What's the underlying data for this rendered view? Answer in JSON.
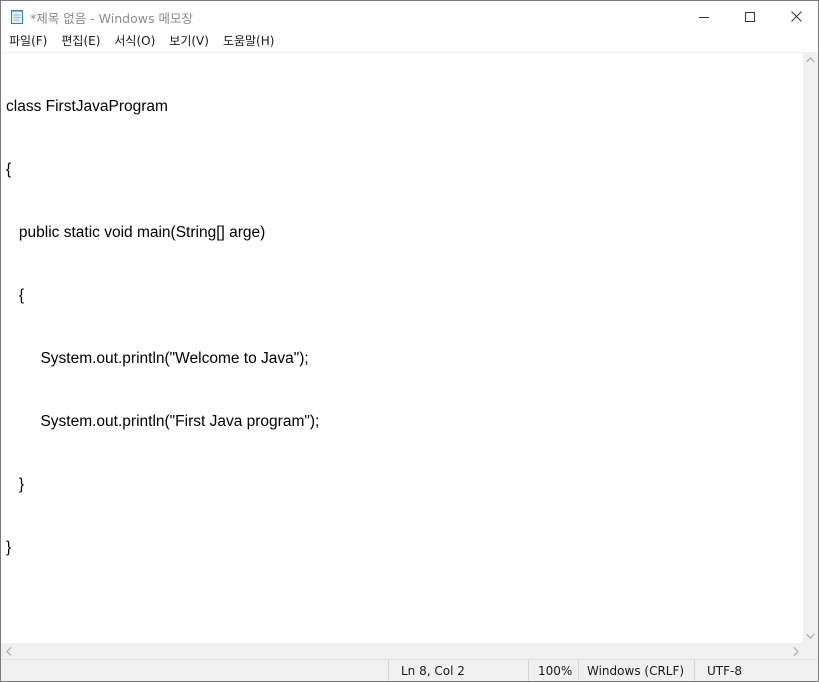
{
  "window": {
    "title": "*제목 없음 - Windows 메모장",
    "app_icon": "notepad-icon"
  },
  "menu": [
    {
      "label": "파일(F)"
    },
    {
      "label": "편집(E)"
    },
    {
      "label": "서식(O)"
    },
    {
      "label": "보기(V)"
    },
    {
      "label": "도움말(H)"
    }
  ],
  "editor": {
    "lines": [
      "class FirstJavaProgram",
      "{",
      "   public static void main(String[] arge)",
      "   {",
      "        System.out.println(\"Welcome to Java\");",
      "        System.out.println(\"First Java program\");",
      "   }",
      "}"
    ]
  },
  "status": {
    "position": "Ln 8, Col 2",
    "zoom": "100%",
    "line_ending": "Windows (CRLF)",
    "encoding": "UTF-8"
  },
  "icons": {
    "minimize": "minimize-icon",
    "maximize": "maximize-icon",
    "close": "close-icon"
  }
}
